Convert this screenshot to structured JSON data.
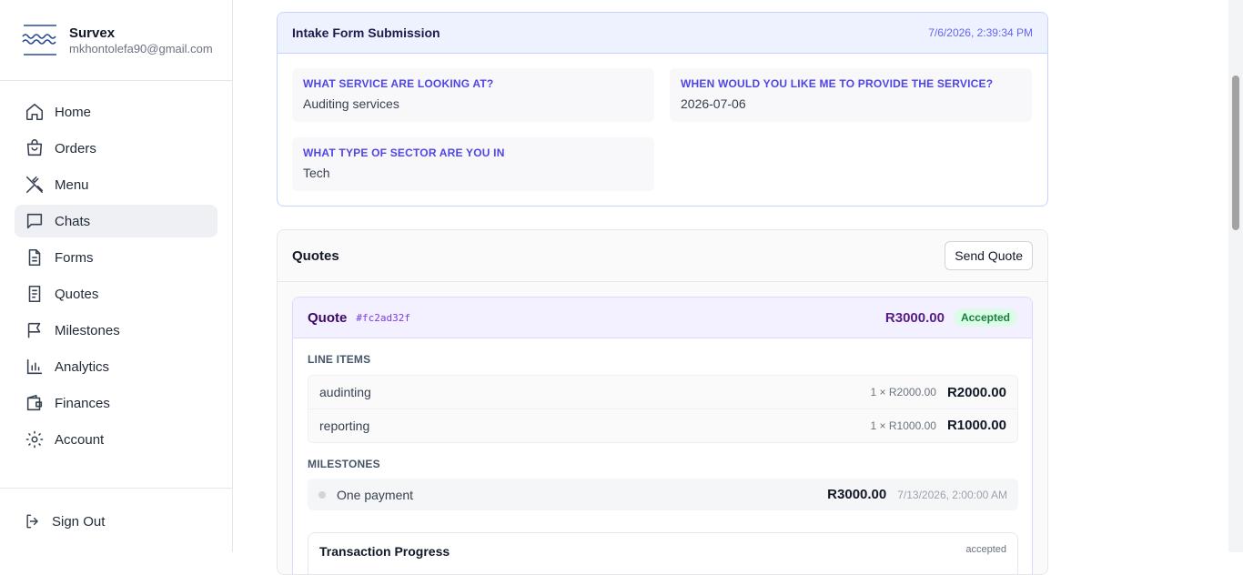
{
  "brand": {
    "name": "Survex",
    "email": "mkhontolefa90@gmail.com",
    "logo_icon": "waves-logo-icon"
  },
  "nav": {
    "items": [
      {
        "label": "Home",
        "icon": "home-icon"
      },
      {
        "label": "Orders",
        "icon": "shopping-bag-icon"
      },
      {
        "label": "Menu",
        "icon": "utensils-icon"
      },
      {
        "label": "Chats",
        "icon": "chat-icon",
        "active": true
      },
      {
        "label": "Forms",
        "icon": "document-icon"
      },
      {
        "label": "Quotes",
        "icon": "receipt-icon"
      },
      {
        "label": "Milestones",
        "icon": "flag-icon"
      },
      {
        "label": "Analytics",
        "icon": "bar-chart-icon"
      },
      {
        "label": "Finances",
        "icon": "wallet-icon"
      },
      {
        "label": "Account",
        "icon": "gear-icon"
      }
    ],
    "sign_out": "Sign Out"
  },
  "intake": {
    "title": "Intake Form Submission",
    "date": "7/6/2026, 2:39:34 PM",
    "fields": [
      {
        "question": "WHAT SERVICE ARE LOOKING AT?",
        "answer": "Auditing services"
      },
      {
        "question": "WHEN WOULD YOU LIKE ME TO PROVIDE THE SERVICE?",
        "answer": "2026-07-06"
      },
      {
        "question": "WHAT TYPE OF SECTOR ARE YOU IN",
        "answer": "Tech"
      }
    ]
  },
  "quotes": {
    "title": "Quotes",
    "send_button": "Send Quote",
    "quote": {
      "label": "Quote",
      "id": "#fc2ad32f",
      "total": "R3000.00",
      "status": "Accepted",
      "line_items_label": "LINE ITEMS",
      "line_items": [
        {
          "name": "audinting",
          "qty": "1 × R2000.00",
          "amount": "R2000.00"
        },
        {
          "name": "reporting",
          "qty": "1 × R1000.00",
          "amount": "R1000.00"
        }
      ],
      "milestones_label": "MILESTONES",
      "milestones": [
        {
          "name": "One payment",
          "amount": "R3000.00",
          "date": "7/13/2026, 2:00:00 AM"
        }
      ],
      "progress_title": "Transaction Progress",
      "progress_status": "accepted"
    }
  },
  "colors": {
    "accent": "#4f46e5",
    "quote_accent": "#581c87",
    "accepted": "#15803d"
  }
}
